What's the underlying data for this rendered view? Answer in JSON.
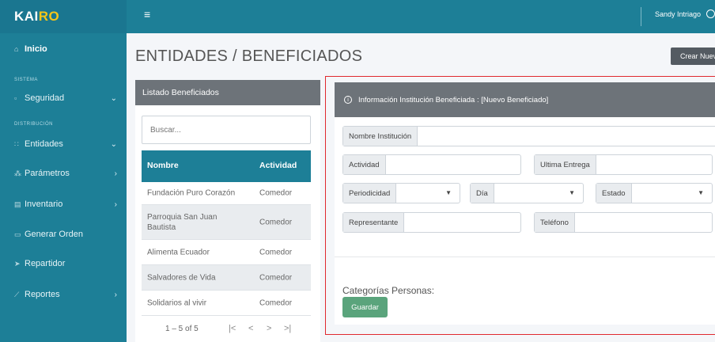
{
  "app": {
    "brand_main": "KAI",
    "brand_accent": "RO",
    "brand_accent_color": "#f5c518"
  },
  "topbar": {
    "user_name": "Sandy Intriago"
  },
  "sidebar": {
    "items": [
      {
        "label": "Inicio",
        "icon": "home-icon"
      },
      {
        "section": "SISTEMA"
      },
      {
        "label": "Seguridad",
        "icon": "lock-icon",
        "chevron": "⌄"
      },
      {
        "section": "DISTRIBUCIÓN"
      },
      {
        "label": "Entidades",
        "icon": "grid-icon",
        "chevron": "⌄"
      },
      {
        "label": "Parámetros",
        "icon": "sliders-icon",
        "chevron": "›"
      },
      {
        "label": "Inventario",
        "icon": "box-icon",
        "chevron": "›"
      },
      {
        "label": "Generar Orden",
        "icon": "document-icon"
      },
      {
        "label": "Repartidor",
        "icon": "send-icon"
      },
      {
        "label": "Reportes",
        "icon": "chart-icon",
        "chevron": "›"
      }
    ]
  },
  "page": {
    "title": "ENTIDADES / BENEFICIADOS",
    "create_button": "Crear Nuevo"
  },
  "list": {
    "header": "Listado Beneficiados",
    "search_placeholder": "Buscar...",
    "columns": [
      "Nombre",
      "Actividad"
    ],
    "rows": [
      [
        "Fundación Puro Corazón",
        "Comedor"
      ],
      [
        "Parroquia San Juan Bautista",
        "Comedor"
      ],
      [
        "Alimenta Ecuador",
        "Comedor"
      ],
      [
        "Salvadores de Vida",
        "Comedor"
      ],
      [
        "Solidarios al vivir",
        "Comedor"
      ]
    ],
    "pagination": {
      "range": "1 – 5 of 5",
      "first": "|<",
      "prev": "<",
      "next": ">",
      "last": ">|"
    }
  },
  "form": {
    "header": "Información Institución Beneficiada : [Nuevo Beneficiado]",
    "fields": {
      "nombre": "Nombre Institución",
      "actividad": "Actividad",
      "ultima_entrega": "Ultima Entrega",
      "periodicidad": "Periodicidad",
      "dia": "Día",
      "estado": "Estado",
      "representante": "Representante",
      "telefono": "Teléfono"
    },
    "categorias_label": "Categorías Personas:",
    "save_button": "Guardar"
  }
}
